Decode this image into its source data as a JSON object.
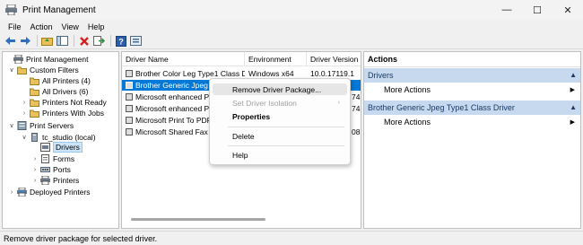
{
  "window": {
    "title": "Print Management",
    "controls": [
      "—",
      "☐",
      "✕"
    ]
  },
  "menu": [
    "File",
    "Action",
    "View",
    "Help"
  ],
  "toolbar": {
    "icons": [
      "back-icon",
      "forward-icon",
      "up-folder-icon",
      "show-hide-tree-icon",
      "delete-icon",
      "export-icon",
      "help-icon",
      "properties-icon"
    ]
  },
  "tree": {
    "items": [
      {
        "label": "Print Management",
        "expander": "",
        "icon": "print-management-icon",
        "level": 0,
        "selected": false
      },
      {
        "label": "Custom Filters",
        "expander": "∨",
        "icon": "folder-icon",
        "level": 1,
        "selected": false
      },
      {
        "label": "All Printers (4)",
        "expander": "",
        "icon": "filter-icon",
        "level": 2,
        "selected": false
      },
      {
        "label": "All Drivers (6)",
        "expander": "",
        "icon": "filter-icon",
        "level": 2,
        "selected": false
      },
      {
        "label": "Printers Not Ready",
        "expander": "›",
        "icon": "filter-icon",
        "level": 2,
        "selected": false
      },
      {
        "label": "Printers With Jobs",
        "expander": "›",
        "icon": "filter-icon",
        "level": 2,
        "selected": false
      },
      {
        "label": "Print Servers",
        "expander": "∨",
        "icon": "server-group-icon",
        "level": 1,
        "selected": false
      },
      {
        "label": "tc_studio (local)",
        "expander": "∨",
        "icon": "server-icon",
        "level": 2,
        "selected": false
      },
      {
        "label": "Drivers",
        "expander": "",
        "icon": "driver-icon",
        "level": 3,
        "selected": true
      },
      {
        "label": "Forms",
        "expander": "›",
        "icon": "forms-icon",
        "level": 3,
        "selected": false
      },
      {
        "label": "Ports",
        "expander": "›",
        "icon": "ports-icon",
        "level": 3,
        "selected": false
      },
      {
        "label": "Printers",
        "expander": "›",
        "icon": "printer-icon",
        "level": 3,
        "selected": false
      },
      {
        "label": "Deployed Printers",
        "expander": "›",
        "icon": "deployed-printers-icon",
        "level": 1,
        "selected": false
      }
    ]
  },
  "list": {
    "columns": [
      "Driver Name",
      "Environment",
      "Driver Version"
    ],
    "rows": [
      {
        "name": "Brother Color Leg Type1 Class D...",
        "env": "Windows x64",
        "ver": "10.0.17119.1",
        "selected": false
      },
      {
        "name": "Brother Generic Jpeg T",
        "env": "",
        "ver": "",
        "selected": true
      },
      {
        "name": "Microsoft enhanced Po",
        "env": "",
        "ver": "74",
        "selected": false
      },
      {
        "name": "Microsoft enhanced Po",
        "env": "",
        "ver": "74",
        "selected": false
      },
      {
        "name": "Microsoft Print To PDF",
        "env": "",
        "ver": "",
        "selected": false
      },
      {
        "name": "Microsoft Shared Fax D",
        "env": "",
        "ver": "08",
        "selected": false
      }
    ]
  },
  "context_menu": {
    "items": [
      {
        "label": "Remove Driver Package...",
        "state": "hover",
        "submenu": false
      },
      {
        "label": "Set Driver Isolation",
        "state": "disabled",
        "submenu": true
      },
      {
        "label": "Properties",
        "state": "bold",
        "submenu": false
      },
      {
        "label": "Delete",
        "state": "normal",
        "submenu": false
      },
      {
        "label": "Help",
        "state": "normal",
        "submenu": false
      }
    ]
  },
  "actions": {
    "title": "Actions",
    "sections": [
      {
        "header": "Drivers",
        "item": "More Actions"
      },
      {
        "header": "Brother Generic Jpeg Type1 Class Driver",
        "item": "More Actions"
      }
    ]
  },
  "status": {
    "text": "Remove driver package for selected driver."
  },
  "colors": {
    "selection": "#0078d7",
    "section_header": "#c7d9ee",
    "tree_selection": "#cce4f7"
  }
}
